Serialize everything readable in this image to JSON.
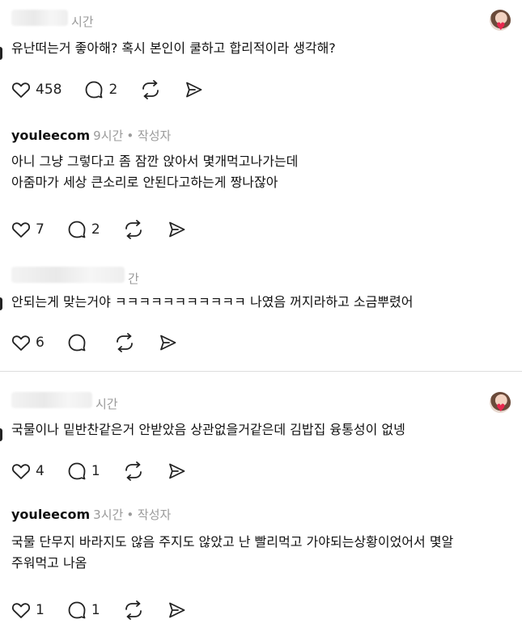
{
  "comments": [
    {
      "username": "",
      "time": "시간",
      "author_tag": "",
      "lines": [
        "유난떠는거 좋아해? 혹시 본인이 쿨하고 합리적이라 생각해?"
      ],
      "likes": "458",
      "replies": "2"
    },
    {
      "username": "youleecom",
      "time": "9시간",
      "author_tag": " • 작성자",
      "lines": [
        "아니 그냥 그렇다고 좀 잠깐 앉아서 몇개먹고나가는데",
        "아줌마가 세상 큰소리로 안된다고하는게 짱나잖아"
      ],
      "likes": "7",
      "replies": "2"
    },
    {
      "username": "",
      "time": "간",
      "author_tag": "",
      "lines": [
        "안되는게 맞는거야 ㅋㅋㅋㅋㅋㅋㅋㅋㅋㅋㅋ 나였음 꺼지라하고 소금뿌렸어"
      ],
      "likes": "6",
      "replies": ""
    },
    {
      "username": "",
      "time": "시간",
      "author_tag": "",
      "lines": [
        "국물이나 밑반찬같은거 안받았음 상관없을거같은데 김밥집 융통성이 없넹"
      ],
      "likes": "4",
      "replies": "1"
    },
    {
      "username": "youleecom",
      "time": "3시간",
      "author_tag": " • 작성자",
      "lines": [
        "국물 단무지 바라지도 않음 주지도 않았고 난 빨리먹고 가야되는상황이었어서 몇알",
        "주워먹고 나옴"
      ],
      "likes": "1",
      "replies": "1"
    }
  ],
  "icons": {
    "like": "heart-outline-icon",
    "reply": "speech-bubble-icon",
    "repost": "repost-arrows-icon",
    "share": "paper-plane-icon",
    "liked_by_author": "author-avatar-heart-icon"
  },
  "colors": {
    "text": "#111111",
    "meta": "#9a9a9a",
    "heart_badge": "#e8284f",
    "divider": "#dddddd"
  }
}
